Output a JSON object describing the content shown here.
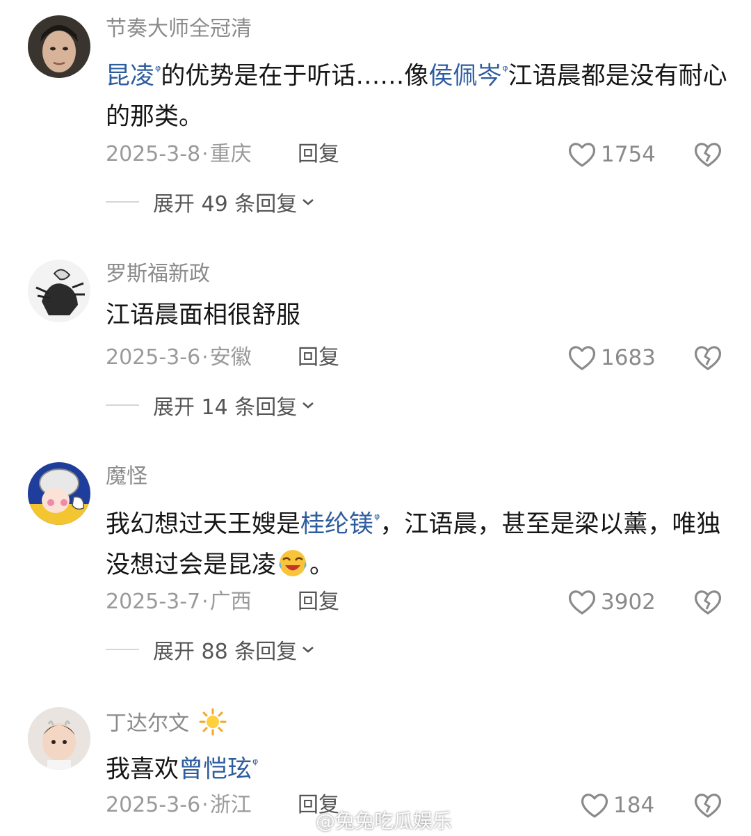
{
  "comments": [
    {
      "username": "节奏大师全冠清",
      "body": [
        {
          "text": "昆凌",
          "mention": true
        },
        {
          "text": "的优势是在于听话……像"
        },
        {
          "text": "侯佩岑",
          "mention": true
        },
        {
          "text": "江语晨都是没有耐心的那类。"
        }
      ],
      "date": "2025-3-8",
      "location": "重庆",
      "reply_label": "回复",
      "likes": "1754",
      "expand_label": "展开 49 条回复"
    },
    {
      "username": "罗斯福新政",
      "body": [
        {
          "text": "江语晨面相很舒服"
        }
      ],
      "date": "2025-3-6",
      "location": "安徽",
      "reply_label": "回复",
      "likes": "1683",
      "expand_label": "展开 14 条回复"
    },
    {
      "username": "魔怪",
      "body": [
        {
          "text": "我幻想过天王嫂是"
        },
        {
          "text": "桂纶镁",
          "mention": true
        },
        {
          "text": "，江语晨，甚至是梁以薰，唯独没想过会是昆凌"
        },
        {
          "emoji": "laughing-crying-emoji"
        },
        {
          "text": "。"
        }
      ],
      "date": "2025-3-7",
      "location": "广西",
      "reply_label": "回复",
      "likes": "3902",
      "expand_label": "展开 88 条回复"
    },
    {
      "username": "丁达尔文",
      "username_badge": "sun-emoji",
      "body": [
        {
          "text": "我喜欢"
        },
        {
          "text": "曾恺玹",
          "mention": true
        }
      ],
      "date": "2025-3-6",
      "location": "浙江",
      "reply_label": "回复",
      "likes": "184"
    }
  ],
  "mention_search_glyph": "ᵠ",
  "watermark": "@兔兔吃瓜娱乐",
  "colors": {
    "mention": "#2e5d9f",
    "meta": "#9a9a9a",
    "username": "#8b8b8b"
  }
}
